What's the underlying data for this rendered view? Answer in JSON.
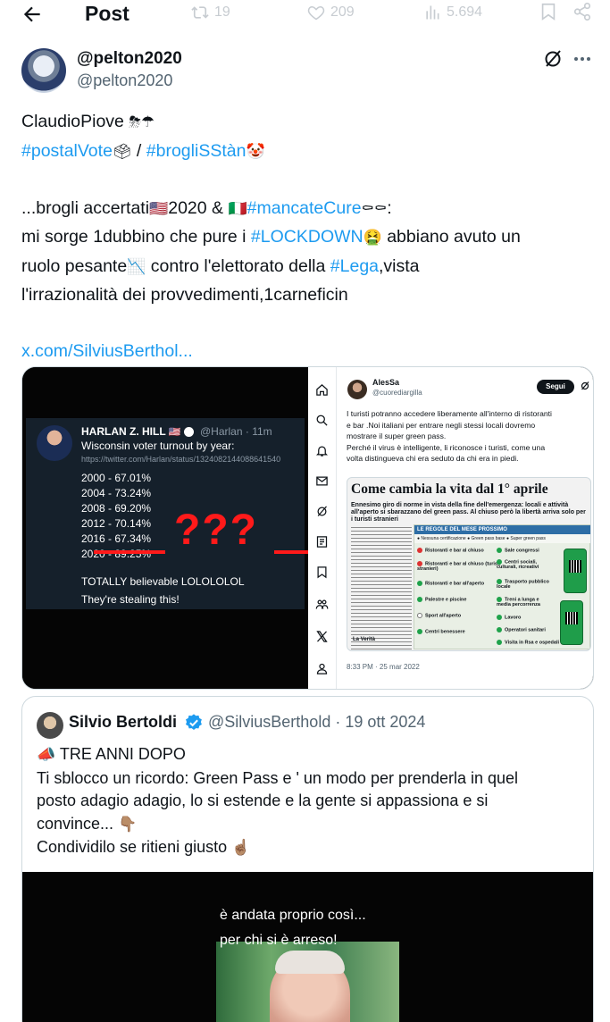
{
  "header": {
    "title": "Post",
    "stats": {
      "reposts": "19",
      "likes": "209",
      "views": "5.694"
    }
  },
  "author": {
    "name": "@pelton2020",
    "handle": "@pelton2020"
  },
  "tweet": {
    "line1": "ClaudioPiove",
    "line1_emoji": "⛈☂",
    "hashtag_postal": "#postalVote",
    "postal_emoji": "🗳",
    "separator": " / ",
    "hashtag_brogli": "#brogliSStàn",
    "brogli_emoji": "🤡",
    "line3_a": "...brogli accertati",
    "flag_us": "🇺🇸",
    "line3_b": "2020 & ",
    "flag_it": "🇮🇹",
    "hashtag_cure": "#mancateCure",
    "coffin_emoji": "⚰⚰",
    "line3_c": ":",
    "line4_a": "mi sorge 1dubbino che pure i ",
    "hashtag_lockdown": "#LOCKDOWN",
    "sick_emoji": "🤮",
    "line4_b": " abbiano avuto un",
    "line5_a": "ruolo pesante",
    "chart_emoji": "📉",
    "line5_b": " contro l'elettorato della ",
    "hashtag_lega": "#Lega",
    "line5_c": ",vista",
    "line6": "l'irrazionalità dei provvedimenti,1carneficin",
    "url": "x.com/SilviusBerthol..."
  },
  "media_left": {
    "name": "HARLAN Z. HILL",
    "flag": "🇺🇸",
    "handle": "@Harlan · 11m",
    "subtitle": "Wisconsin voter turnout by year:",
    "url": "https://twitter.com/Harlan/status/1324082144088641540",
    "rows": [
      "2000 - 67.01%",
      "2004 - 73.24%",
      "2008 - 69.20%",
      "2012 - 70.14%",
      "2016 - 67.34%",
      "2020 - 89.25%"
    ],
    "question_marks": "???",
    "foot1": "TOTALLY believable LOLOLOLOL",
    "foot2": "They're stealing this!"
  },
  "media_right": {
    "name": "AlesSa",
    "handle": "@cuorediargilla",
    "follow": "Segui",
    "text_lines": [
      "I turisti potranno accedere liberamente all'interno di ristoranti",
      "e bar .Noi italiani per entrare negli stessi locali dovremo",
      "mostrare il super green pass.",
      "Perché il virus è intelligente, li riconosce i turisti, come una",
      "volta distingueva chi era seduto da chi era in piedi."
    ],
    "headline": "Come cambia la vita dal 1° aprile",
    "subhead": "Ennesimo giro di norme in vista della fine dell'emergenza: locali e attività all'aperto si sbarazzano del green pass. Al chiuso però la libertà arriva solo per i turisti stranieri",
    "table_title": "LE REGOLE DEL MESE PROSSIMO",
    "legend": "● Nessuna certificazione  ● Green pass base  ● Super green pass",
    "left_items": [
      "Ristoranti e bar al chiuso",
      "Ristoranti e bar al chiuso (turisti stranieri)",
      "Ristoranti e bar all'aperto",
      "Palestre e piscine",
      "Sport all'aperto",
      "Centri benessere"
    ],
    "right_items": [
      "Sale congressi",
      "Centri sociali, culturali, ricreativi",
      "Trasporto pubblico locale",
      "Treni a lunga e media percorrenza",
      "Lavoro",
      "Operatori sanitari",
      "Visita in Rsa e ospedali"
    ],
    "verita": "La Verità",
    "timestamp": "8:33 PM · 25 mar 2022"
  },
  "quote": {
    "name": "Silvio Bertoldi",
    "handle": "@SilviusBerthold · 19 ott 2024",
    "megaphone": "📣",
    "line1": " TRE ANNI DOPO",
    "line2": "Ti sblocco un ricordo: Green Pass e ' un modo per prenderla in quel",
    "line3": "posto adagio adagio, lo si estende e la gente si appassiona e si",
    "line4": "convince...",
    "point_down": "👇🏽",
    "line5": "Condividilo se ritieni giusto",
    "point_up": "☝🏽",
    "video_caption1": "è andata proprio così...",
    "video_caption2": "per chi si è arreso!"
  },
  "colors": {
    "link": "#1d9bf0",
    "text": "#0f1419",
    "muted": "#536471",
    "border": "#cfd9de"
  }
}
